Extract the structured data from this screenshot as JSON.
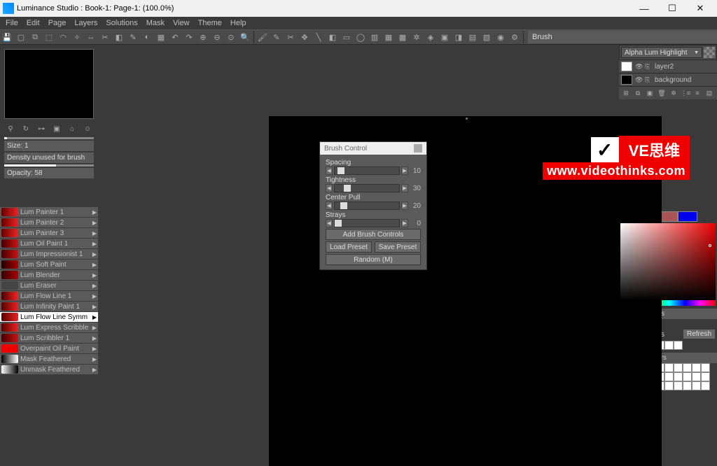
{
  "titlebar": {
    "title": "Luminance Studio : Book-1: Page-1: (100.0%)"
  },
  "menu": [
    "File",
    "Edit",
    "Page",
    "Layers",
    "Solutions",
    "Mask",
    "View",
    "Theme",
    "Help"
  ],
  "toolbar_label": "Brush",
  "size_panel": {
    "size_label": "Size: 1",
    "density_label": "Density unused for brush",
    "opacity_label": "Opacity: 58"
  },
  "brushes": [
    {
      "name": "Lum Painter 1",
      "bg": "linear-gradient(90deg,#600,#e22)",
      "sel": false
    },
    {
      "name": "Lum Painter 2",
      "bg": "linear-gradient(90deg,#600,#e22)",
      "sel": false
    },
    {
      "name": "Lum Painter 3",
      "bg": "linear-gradient(90deg,#600,#e22)",
      "sel": false
    },
    {
      "name": "Lum Oil Paint 1",
      "bg": "linear-gradient(90deg,#400,#c11)",
      "sel": false
    },
    {
      "name": "Lum Impressionist 1",
      "bg": "linear-gradient(90deg,#400,#c11)",
      "sel": false
    },
    {
      "name": "Lum Soft Paint",
      "bg": "linear-gradient(90deg,#200,#a00)",
      "sel": false
    },
    {
      "name": "Lum Blender",
      "bg": "linear-gradient(90deg,#300,#a00)",
      "sel": false
    },
    {
      "name": "Lum Eraser",
      "bg": "#444",
      "sel": false
    },
    {
      "name": "Lum Flow Line 1",
      "bg": "linear-gradient(90deg,#400,#f22)",
      "sel": false
    },
    {
      "name": "Lum Infinity Paint 1",
      "bg": "linear-gradient(90deg,#500,#e22)",
      "sel": false
    },
    {
      "name": "Lum Flow Line Symm",
      "bg": "linear-gradient(90deg,#500,#e22)",
      "sel": true
    },
    {
      "name": "Lum Express Scribble",
      "bg": "linear-gradient(90deg,#500,#e22)",
      "sel": false
    },
    {
      "name": "Lum Scribbler 1",
      "bg": "linear-gradient(90deg,#400,#c11)",
      "sel": false
    },
    {
      "name": "Overpaint Oil Paint",
      "bg": "#e00",
      "sel": false
    },
    {
      "name": "Mask Feathered",
      "bg": "linear-gradient(90deg,#000,#fff)",
      "sel": false
    },
    {
      "name": "Unmask Feathered",
      "bg": "linear-gradient(90deg,#fff,#000)",
      "sel": false
    }
  ],
  "brush_control": {
    "title": "Brush Control",
    "sliders": [
      {
        "label": "Spacing",
        "val": "10",
        "pos": "4%"
      },
      {
        "label": "Tightness",
        "val": "30",
        "pos": "14%"
      },
      {
        "label": "Center Pull",
        "val": "20",
        "pos": "9%"
      },
      {
        "label": "Strays",
        "val": "0",
        "pos": "0%"
      }
    ],
    "add_btn": "Add Brush Controls",
    "load_btn": "Load Preset",
    "save_btn": "Save Preset",
    "random_btn": "Random (M)"
  },
  "watermark": {
    "ve": "VE思维",
    "url": "www.videothinks.com"
  },
  "layers": {
    "mode": "Alpha Lum Highlight",
    "items": [
      {
        "name": "layer2",
        "thumb": "#fff"
      },
      {
        "name": "background",
        "thumb": "#000"
      }
    ]
  },
  "swatches": [
    "#e00",
    "#0c0",
    "#a55",
    "#00e"
  ],
  "recent_label": "Recent colors",
  "image_colors_label": "Image colors",
  "refresh_label": "Refresh",
  "custom_label": "Custom colors",
  "hue": [
    "#f00",
    "#ff0",
    "#0f0",
    "#0ff",
    "#00f",
    "#f0f",
    "#f00"
  ]
}
